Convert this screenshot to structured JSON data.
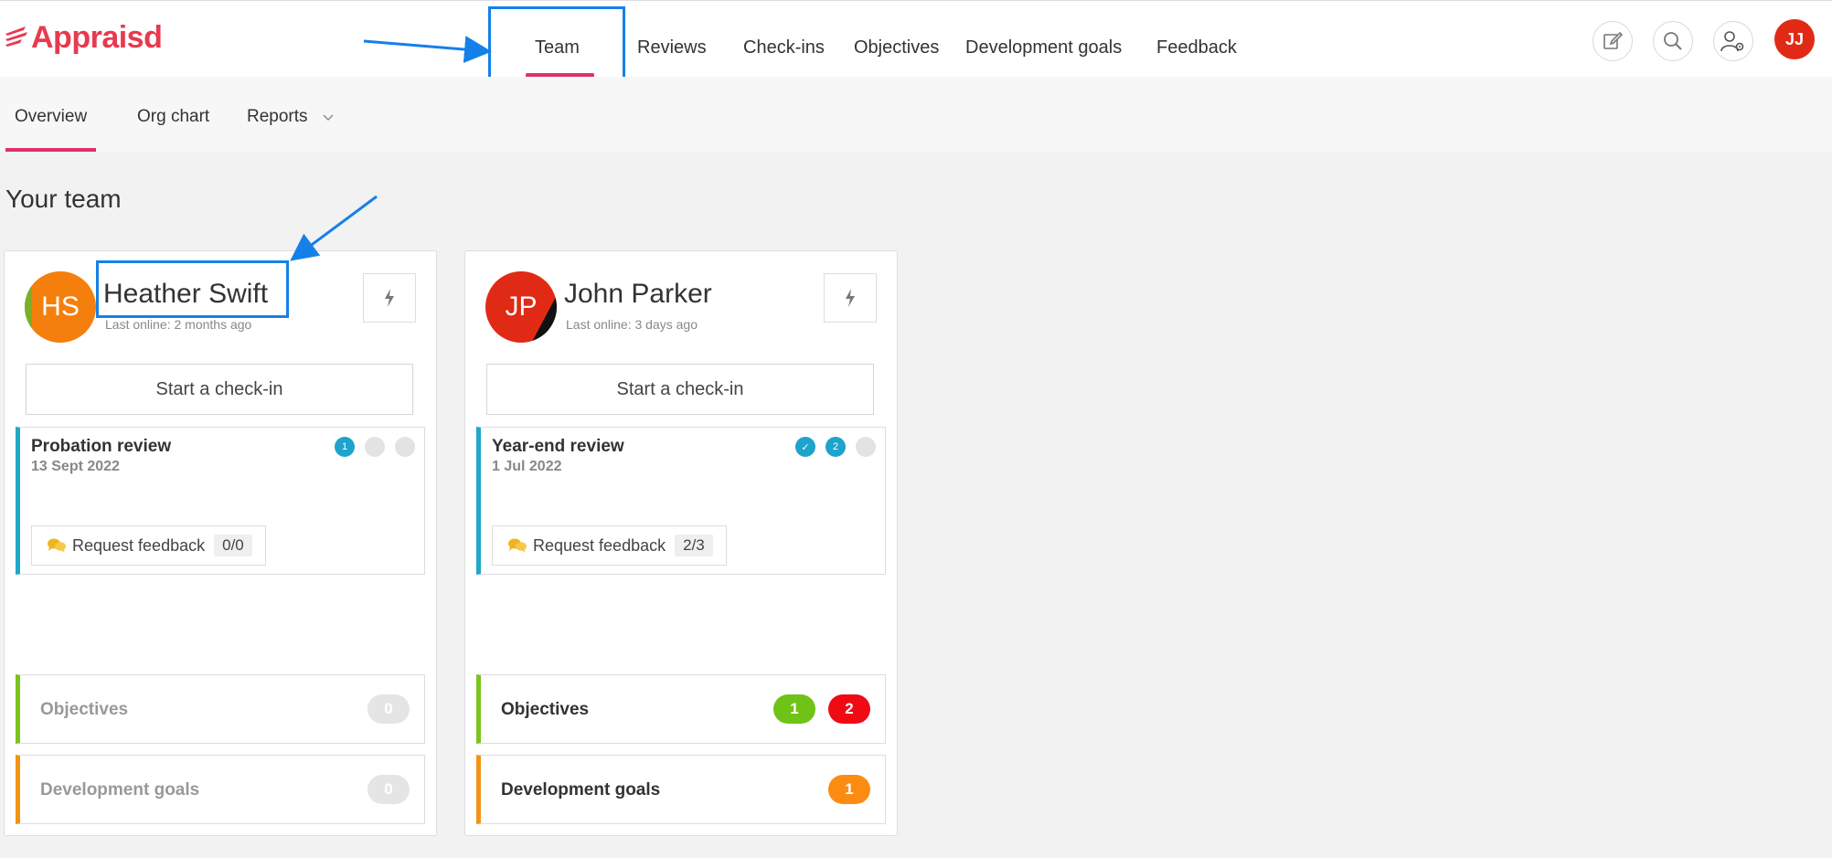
{
  "app": {
    "logo_text": "Appraisd",
    "user_initials": "JJ"
  },
  "nav": {
    "items": [
      {
        "label": "Team",
        "active": true
      },
      {
        "label": "Reviews"
      },
      {
        "label": "Check-ins"
      },
      {
        "label": "Objectives"
      },
      {
        "label": "Development goals"
      },
      {
        "label": "Feedback"
      }
    ]
  },
  "toolbar_icons": [
    "edit-icon",
    "search-icon",
    "user-settings-icon"
  ],
  "subnav": {
    "items": [
      {
        "label": "Overview",
        "active": true
      },
      {
        "label": "Org chart"
      },
      {
        "label": "Reports"
      }
    ]
  },
  "page": {
    "heading": "Your team"
  },
  "team": [
    {
      "initials": "HS",
      "name": "Heather Swift",
      "last_online": "Last online: 2 months ago",
      "avatar_color": "#f57f0d",
      "checkin_label": "Start a check-in",
      "review": {
        "title": "Probation review",
        "date": "13 Sept 2022",
        "steps": [
          "1",
          "",
          ""
        ],
        "feedback_label": "Request feedback",
        "feedback_count": "0/0"
      },
      "objectives": {
        "label": "Objectives",
        "counts": [
          "0"
        ]
      },
      "dev_goals": {
        "label": "Development goals",
        "counts": [
          "0"
        ]
      }
    },
    {
      "initials": "JP",
      "name": "John Parker",
      "last_online": "Last online: 3 days ago",
      "avatar_color": "#e12a15",
      "checkin_label": "Start a check-in",
      "review": {
        "title": "Year-end review",
        "date": "1 Jul 2022",
        "steps": [
          "✓",
          "2",
          ""
        ],
        "feedback_label": "Request feedback",
        "feedback_count": "2/3"
      },
      "objectives": {
        "label": "Objectives",
        "counts": [
          "1",
          "2"
        ]
      },
      "dev_goals": {
        "label": "Development goals",
        "counts": [
          "1"
        ]
      }
    }
  ],
  "colors": {
    "brand": "#e8394f",
    "active_underline": "#e0306c",
    "annotation": "#1580e8",
    "review_border": "#21a7c9",
    "objectives_border": "#7cc31c",
    "dev_goals_border": "#f39315"
  }
}
